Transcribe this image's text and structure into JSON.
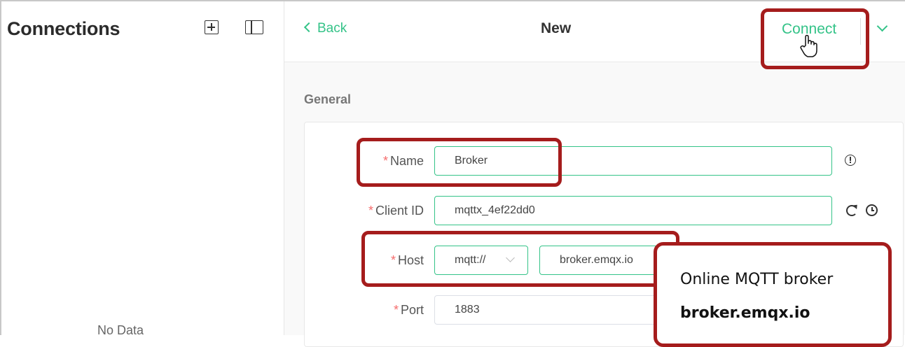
{
  "sidebar": {
    "title": "Connections",
    "empty_text": "No Data"
  },
  "header": {
    "back_label": "Back",
    "title": "New",
    "connect_label": "Connect"
  },
  "general": {
    "section_title": "General",
    "name": {
      "label": "Name",
      "value": "Broker"
    },
    "client_id": {
      "label": "Client ID",
      "value": "mqttx_4ef22dd0"
    },
    "host": {
      "label": "Host",
      "protocol": "mqtt://",
      "value": "broker.emqx.io"
    },
    "port": {
      "label": "Port",
      "value": "1883"
    }
  },
  "annotation": {
    "line1": "Online MQTT broker",
    "line2": "broker.emqx.io"
  },
  "colors": {
    "accent": "#34c388",
    "required": "#f56c6c",
    "highlight": "#a51c1c"
  },
  "icons": [
    "add-icon",
    "sidebar-toggle-icon",
    "back-chevron-icon",
    "chevron-down-icon",
    "hand-pointer-icon",
    "info-icon",
    "refresh-icon",
    "clock-icon"
  ]
}
